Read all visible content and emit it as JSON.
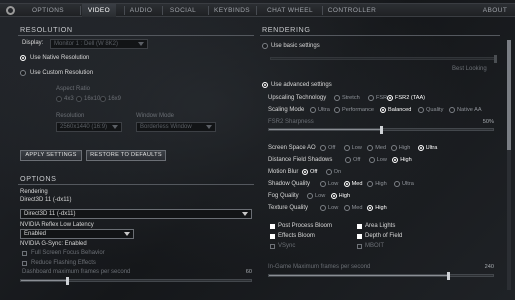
{
  "tabs": [
    "OPTIONS",
    "VIDEO",
    "AUDIO",
    "SOCIAL",
    "KEYBINDS",
    "CHAT WHEEL",
    "CONTROLLER",
    "ABOUT"
  ],
  "active_tab": "VIDEO",
  "resolution": {
    "title": "RESOLUTION",
    "display_label": "Display:",
    "display_value": "Monitor 1 : Dell (W 8K2)",
    "native_label": "Use Native Resolution",
    "custom_label": "Use Custom Resolution",
    "aspect_label": "Aspect Ratio",
    "aspect_options": [
      "4x3",
      "16x10",
      "16x9"
    ],
    "res_label": "Resolution",
    "res_value": "2560x1440 (16:9)",
    "window_label": "Window Mode",
    "window_value": "Borderless Window",
    "apply": "APPLY SETTINGS",
    "restore": "RESTORE TO DEFAULTS"
  },
  "options": {
    "title": "OPTIONS",
    "rendering_label": "Rendering",
    "rendering_api": "Direct3D 11 (-dx11)",
    "rendering_dropdown": "Direct3D 11 (-dx11)",
    "reflex_label": "NVIDIA Reflex Low Latency",
    "reflex_value": "Enabled",
    "gsync": "NVIDIA G-Sync: Enabled",
    "fullscreen_focus": "Full Screen Focus Behavior",
    "reduce_flashing": "Reduce Flashing Effects",
    "dashboard_fps_label": "Dashboard maximum frames per second",
    "dashboard_fps_value": "60",
    "dashboard_fps_fraction": 0.2
  },
  "rendering": {
    "title": "RENDERING",
    "basic_label": "Use basic settings",
    "basic_right": "Best Looking",
    "advanced_label": "Use advanced settings",
    "upscaling_label": "Upscaling Technology",
    "upscaling_options": [
      "Stretch",
      "FSR",
      "FSR2 (TAA)"
    ],
    "upscaling_selected": "FSR2 (TAA)",
    "scaling_label": "Scaling Mode",
    "scaling_options": [
      "Ultra",
      "Performance",
      "Balanced",
      "Quality",
      "Native AA"
    ],
    "scaling_selected": "Balanced",
    "sharpness_label": "FSR2 Sharpness",
    "sharpness_value": "50%",
    "sharpness_fraction": 0.5,
    "ssao_label": "Screen Space AO",
    "ssao_options": [
      "Off",
      "Low",
      "Med",
      "High",
      "Ultra"
    ],
    "ssao_selected": "Ultra",
    "dist_shadows_label": "Distance Field Shadows",
    "dist_shadows_options": [
      "Off",
      "Low",
      "High"
    ],
    "dist_shadows_selected": "High",
    "motion_blur_label": "Motion Blur",
    "motion_blur_options": [
      "Off",
      "On"
    ],
    "motion_blur_selected": "Off",
    "shadow_label": "Shadow Quality",
    "shadow_options": [
      "Low",
      "Med",
      "High",
      "Ultra"
    ],
    "shadow_selected": "Med",
    "fog_label": "Fog Quality",
    "fog_options": [
      "Low",
      "High"
    ],
    "fog_selected": "High",
    "texture_label": "Texture Quality",
    "texture_options": [
      "Low",
      "Med",
      "High"
    ],
    "texture_selected": "High",
    "checks": [
      {
        "label": "Post Process Bloom",
        "on": true
      },
      {
        "label": "Area Lights",
        "on": true
      },
      {
        "label": "Effects Bloom",
        "on": true
      },
      {
        "label": "Depth of Field",
        "on": true
      },
      {
        "label": "VSync",
        "on": false
      },
      {
        "label": "MBOIT",
        "on": false
      }
    ],
    "ingame_fps_label": "In-Game Maximum frames per second",
    "ingame_fps_value": "240",
    "ingame_fps_fraction": 0.8
  }
}
